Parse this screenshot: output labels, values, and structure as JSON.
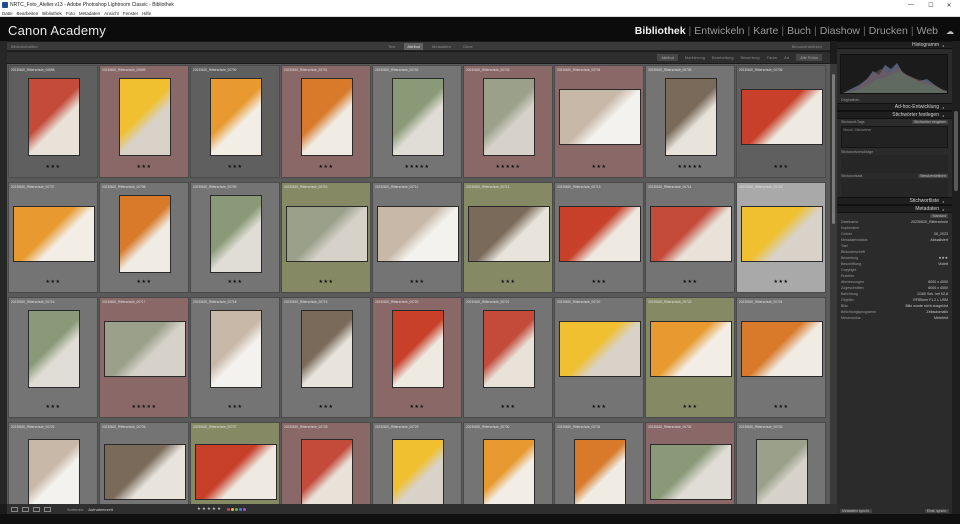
{
  "window": {
    "title": "NRTC_Foto_Atelier.v13 - Adobe Photoshop Lightroom Classic - Bibliothek",
    "minimize": "—",
    "maximize": "☐",
    "close": "✕"
  },
  "menu": [
    "Datei",
    "Bearbeiten",
    "Bibliothek",
    "Foto",
    "Metadaten",
    "Ansicht",
    "Fenster",
    "Hilfe"
  ],
  "identity_plate": "Canon Academy",
  "modules": [
    "Bibliothek",
    "Entwickeln",
    "Karte",
    "Buch",
    "Diashow",
    "Drucken",
    "Web"
  ],
  "active_module": "Bibliothek",
  "filterbar": {
    "left": "Bibliotheksfilter",
    "tabs": [
      "Text",
      "Attribut",
      "Metadaten",
      "Ohne"
    ],
    "selected": "Attribut",
    "right": "Benutzerdefiniert"
  },
  "sortbar": [
    "Attribut",
    "Markierung",
    "Bearbeitung",
    "Bewertung",
    "Farbe",
    "Art",
    "Alle Fotos"
  ],
  "grid": {
    "rows": [
      {
        "captions": [
          "20230620_Ritterschule_00698",
          "20230620_Ritterschule_00699",
          "20230620_Ritterschule_00700",
          "20230620_Ritterschule_00701",
          "20230620_Ritterschule_00702",
          "20230620_Ritterschule_00703",
          "20230620_Ritterschule_00704",
          "20230620_Ritterschule_00705",
          "20230620_Ritterschule_00706"
        ],
        "stars": [
          "★★★",
          "★★★",
          "★★★",
          "★★★",
          "★★★★★",
          "★★★★★",
          "★★★",
          "★★★★★",
          "★★★"
        ]
      },
      {
        "captions": [
          "20230620_Ritterschule_00707",
          "20230620_Ritterschule_00708",
          "20230620_Ritterschule_00709",
          "20230620_Ritterschule_00710",
          "20230620_Ritterschule_00711",
          "20230620_Ritterschule_00712",
          "20230620_Ritterschule_00713",
          "20230620_Ritterschule_00714",
          "20230620_Ritterschule_00715"
        ],
        "stars": [
          "★★★",
          "★★★",
          "★★★",
          "★★★",
          "★★★",
          "★★★",
          "★★★",
          "★★★",
          "★★★"
        ]
      },
      {
        "captions": [
          "20230620_Ritterschule_00716",
          "20230620_Ritterschule_00717",
          "20230620_Ritterschule_00718",
          "20230620_Ritterschule_00719",
          "20230620_Ritterschule_00720",
          "20230620_Ritterschule_00721",
          "20230620_Ritterschule_00722",
          "20230620_Ritterschule_00723",
          "20230620_Ritterschule_00724"
        ],
        "stars": [
          "★★★",
          "★★★★★",
          "★★★",
          "★★★",
          "★★★",
          "★★★",
          "★★★",
          "★★★",
          "★★★"
        ]
      },
      {
        "captions": [
          "20230620_Ritterschule_00725",
          "20230620_Ritterschule_00726",
          "20230620_Ritterschule_00727",
          "20230620_Ritterschule_00728",
          "20230620_Ritterschule_00729",
          "20230620_Ritterschule_00730",
          "20230620_Ritterschule_00731",
          "20230620_Ritterschule_00732",
          "20230620_Ritterschule_00733"
        ],
        "stars": [
          "",
          "",
          "",
          "",
          "",
          "",
          "",
          "",
          ""
        ]
      }
    ]
  },
  "right_panel": {
    "histogram": "Histogramm",
    "original": "Originalfoto",
    "quick_develop": "Ad-hoc-Entwicklung",
    "keywording": "Stichwörter festlegen",
    "keyword_tags_label": "Stichwort-Tags",
    "keyword_tags_value": "Stichwörter eingeben",
    "keyword_hint": "Hinzuf. Stichwörter",
    "keyword_suggestions": "Stichwortvorschläge",
    "keyword_set": "Stichwortsatz",
    "keyword_set_value": "Benutzerdefiniert",
    "keyword_list": "Stichwortliste",
    "metadata": "Metadaten",
    "metadata_preset": "Standard",
    "fields": [
      {
        "label": "Dateiname",
        "value": "20230620_Ritterschule"
      },
      {
        "label": "Kopiename",
        "value": ""
      },
      {
        "label": "Ordner",
        "value": "06_2023"
      },
      {
        "label": "Metadatenstatus",
        "value": "Aktualisiert"
      },
      {
        "label": "Titel",
        "value": ""
      },
      {
        "label": "Bildunterschrift",
        "value": ""
      },
      {
        "label": "Bewertung",
        "value": "★★★"
      },
      {
        "label": "Beschriftung",
        "value": "Violett"
      },
      {
        "label": "Copyright",
        "value": ""
      },
      {
        "label": "Ersteller",
        "value": ""
      },
      {
        "label": "Abmessungen",
        "value": "6000 x 4000"
      },
      {
        "label": "Zugeschnitten",
        "value": "6000 x 4000"
      },
      {
        "label": "Belichtung",
        "value": "1/160 Sek. bei f/2,8"
      },
      {
        "label": "Objektiv",
        "value": "RF85mm F1.2 L USM"
      },
      {
        "label": "Blitz",
        "value": "Blitz wurde nicht ausgelöst"
      },
      {
        "label": "Belichtungsprogramm",
        "value": "Zeitautomatik"
      },
      {
        "label": "Messmodus",
        "value": "Mehrfeld"
      }
    ],
    "sync_metadata": "Metadaten synchr.",
    "sync_settings": "Einst. synchr."
  },
  "toolbar": {
    "sort_label": "Sortieren:",
    "sort_value": "Aufnahmezeit",
    "rating": "★★★★★"
  },
  "colors": {
    "cell_default": "#747474",
    "cell_red": "#8a6868",
    "cell_green": "#868a64",
    "accent_active": "#f2f2f2"
  },
  "label_colors": [
    "#d24a4a",
    "#d6c24a",
    "#5db35d",
    "#4a7fd6",
    "#9a5bc9"
  ]
}
